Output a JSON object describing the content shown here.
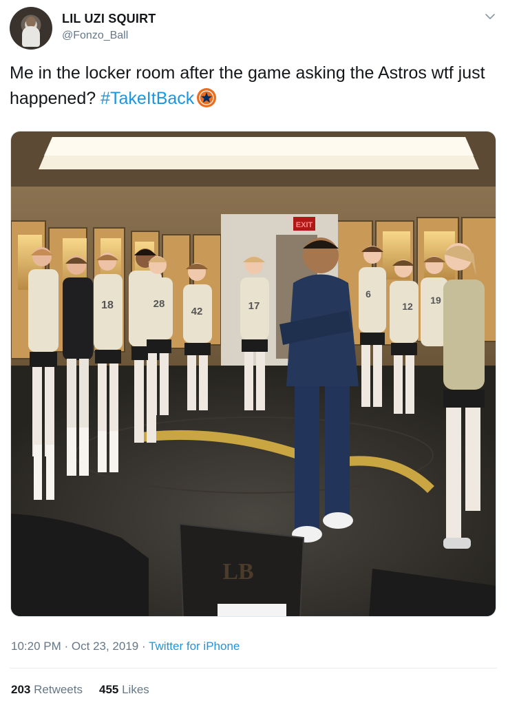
{
  "author": {
    "display_name": "LIL UZI SQUIRT",
    "handle": "@Fonzo_Ball",
    "avatar_icon": "profile-avatar"
  },
  "tweet": {
    "text": "Me in the locker room after the game asking the Astros wtf just happened?",
    "hashtag": "#TakeItBack",
    "hashtag_emoji": "astros-hashflag-icon",
    "image_alt": "photo"
  },
  "meta": {
    "time": "10:20 PM",
    "separator": "·",
    "date": "Oct 23, 2019",
    "source": "Twitter for iPhone"
  },
  "stats": {
    "retweets_count": "203",
    "retweets_label": "Retweets",
    "likes_count": "455",
    "likes_label": "Likes"
  },
  "photo_text": {
    "exit_sign": "EXIT",
    "chair_logo": "LB",
    "jerseys": [
      "18",
      "28",
      "42",
      "17",
      "6",
      "12",
      "19"
    ]
  },
  "colors": {
    "link": "#1b95e0",
    "secondary_text": "#657786",
    "primary_text": "#14171a",
    "divider": "#e6ecf0"
  }
}
